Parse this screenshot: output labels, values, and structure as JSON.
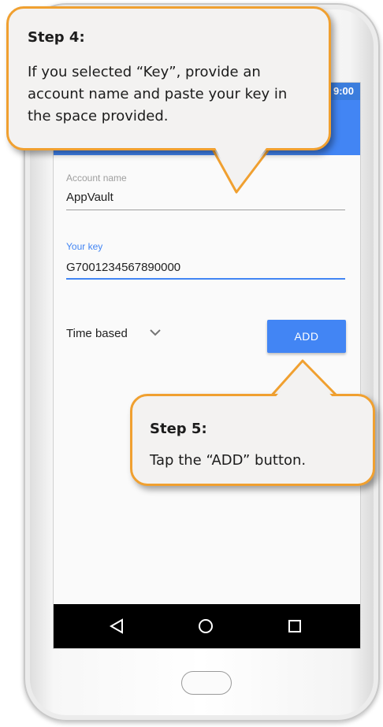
{
  "status_bar": {
    "time": "9:00"
  },
  "form": {
    "account_name": {
      "label": "Account name",
      "value": "AppVault"
    },
    "your_key": {
      "label": "Your key",
      "value": "G7001234567890000"
    },
    "time_based": {
      "label": "Time based"
    },
    "add_button": {
      "label": "ADD"
    }
  },
  "callouts": {
    "step4": {
      "title": "Step 4:",
      "body": "If you selected “Key”, provide an account name and paste your key in the space provided."
    },
    "step5": {
      "title": "Step 5:",
      "body": "Tap the “ADD” button."
    }
  },
  "colors": {
    "accent": "#4285f4",
    "callout_border": "#f0a030",
    "callout_bg": "#f3f2f1",
    "navbar": "#000000"
  },
  "icons": {
    "time_based_dropdown": "chevron-down-icon",
    "nav_back": "back-triangle-icon",
    "nav_home": "home-circle-icon",
    "nav_recents": "recents-square-icon"
  }
}
